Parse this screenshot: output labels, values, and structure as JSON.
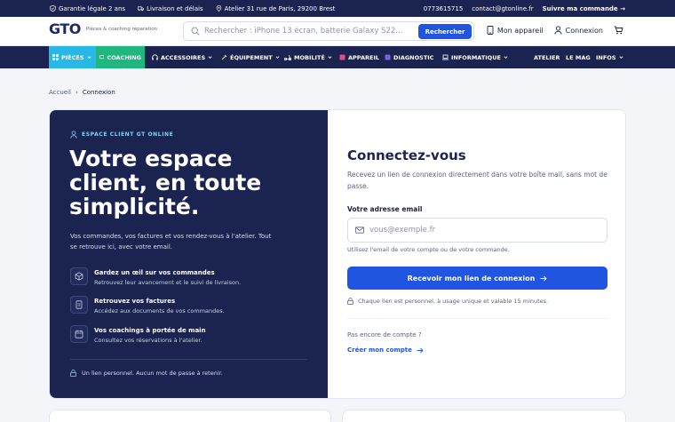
{
  "topbar": {
    "guarantee": "Garantie légale 2 ans",
    "delivery": "Livraison et délais",
    "address": "Atelier 31 rue de Paris, 29200 Brest",
    "phone": "0773615715",
    "email": "contact@gtonline.fr",
    "track": "Suivre ma commande →"
  },
  "header": {
    "logo": "GTO",
    "tagline": "Pièces & coaching réparation",
    "search_placeholder": "Rechercher : iPhone 13 écran, batterie Galaxy S22...",
    "search_button": "Rechercher",
    "my_device": "Mon appareil",
    "login": "Connexion"
  },
  "nav": {
    "pieces": "PIÈCES",
    "coaching": "COACHING",
    "accessoires": "ACCESSOIRES",
    "equipement": "ÉQUIPEMENT",
    "mobilite": "MOBILITÉ",
    "appareil": "APPAREIL",
    "diagnostic": "DIAGNOSTIC",
    "informatique": "INFORMATIQUE",
    "atelier": "ATELIER",
    "mag": "LE MAG",
    "infos": "INFOS"
  },
  "breadcrumb": {
    "home": "Accueil",
    "sep": "›",
    "current": "Connexion"
  },
  "left": {
    "eyebrow": "ESPACE CLIENT GT ONLINE",
    "title": "Votre espace client, en toute simplicité.",
    "desc": "Vos commandes, vos factures et vos rendez-vous à l'atelier. Tout se retrouve ici, avec votre email.",
    "features": [
      {
        "title": "Gardez un œil sur vos commandes",
        "sub": "Retrouvez leur avancement et le suivi de livraison."
      },
      {
        "title": "Retrouvez vos factures",
        "sub": "Accédez aux documents de vos commandes."
      },
      {
        "title": "Vos coachings à portée de main",
        "sub": "Consultez vos réservations à l'atelier."
      }
    ],
    "footnote": "Un lien personnel. Aucun mot de passe à retenir."
  },
  "right": {
    "title": "Connectez-vous",
    "desc": "Recevez un lien de connexion directement dans votre boîte mail, sans mot de passe.",
    "email_label": "Votre adresse email",
    "email_placeholder": "vous@exemple.fr",
    "hint": "Utilisez l'email de votre compte ou de votre commande.",
    "submit": "Recevoir mon lien de connexion",
    "note": "Chaque lien est personnel, à usage unique et valable 15 minutes.",
    "no_account": "Pas encore de compte ?",
    "create": "Créer mon compte"
  },
  "colors": {
    "navy": "#1b2450",
    "primary": "#1f55e0",
    "cyan": "#29b8e5",
    "green": "#1fb77f"
  }
}
